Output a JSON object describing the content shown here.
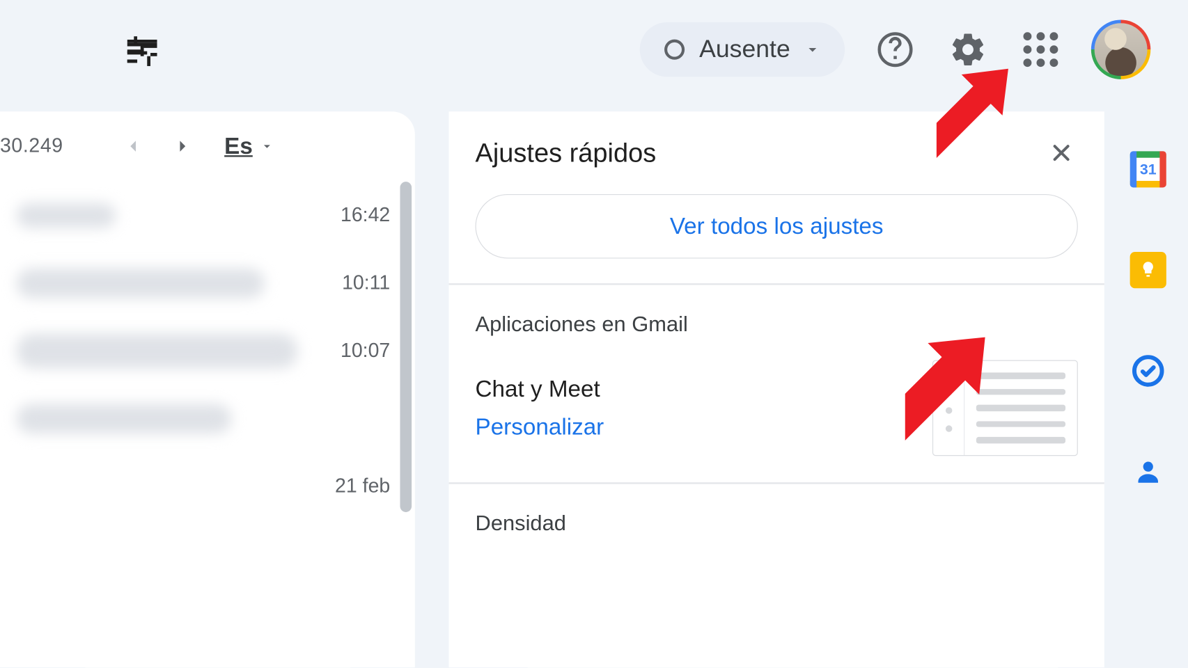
{
  "header": {
    "status_label": "Ausente"
  },
  "mail": {
    "count_fragment": "30.249",
    "language_label": "Es",
    "rows": [
      {
        "time": "16:42"
      },
      {
        "time": "10:11"
      },
      {
        "time": "10:07"
      },
      {
        "time": ""
      },
      {
        "time": "21 feb"
      }
    ]
  },
  "settings": {
    "title": "Ajustes rápidos",
    "all_settings_label": "Ver todos los ajustes",
    "apps_section_title": "Aplicaciones en Gmail",
    "chat_meet_label": "Chat y Meet",
    "customize_link": "Personalizar",
    "density_section_title": "Densidad"
  },
  "sidebar": {
    "calendar_day": "31"
  }
}
